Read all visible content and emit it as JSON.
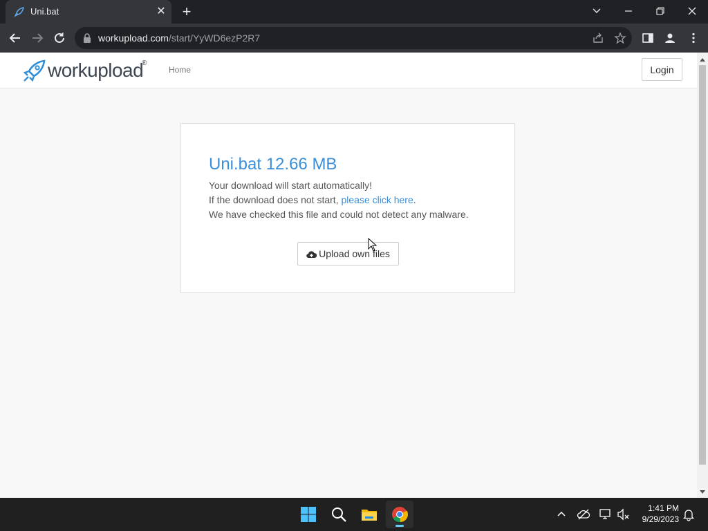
{
  "browser": {
    "tab_title": "Uni.bat",
    "tab_close": "✕",
    "new_tab": "+",
    "url_host": "workupload.com",
    "url_path": "/start/YyWD6ezP2R7"
  },
  "site": {
    "logo_text": "workupload",
    "logo_mark": "®",
    "nav_home": "Home",
    "login": "Login"
  },
  "card": {
    "title": "Uni.bat 12.66 MB",
    "line1": "Your download will start automatically!",
    "line2_prefix": "If the download does not start, ",
    "line2_link": "please click here",
    "line2_suffix": ".",
    "line3": "We have checked this file and could not detect any malware.",
    "upload_button": "Upload own files"
  },
  "taskbar": {
    "time": "1:41 PM",
    "date": "9/29/2023"
  },
  "colors": {
    "accent": "#3a8fd9",
    "browser_bg": "#202124",
    "toolbar_bg": "#35363a"
  }
}
